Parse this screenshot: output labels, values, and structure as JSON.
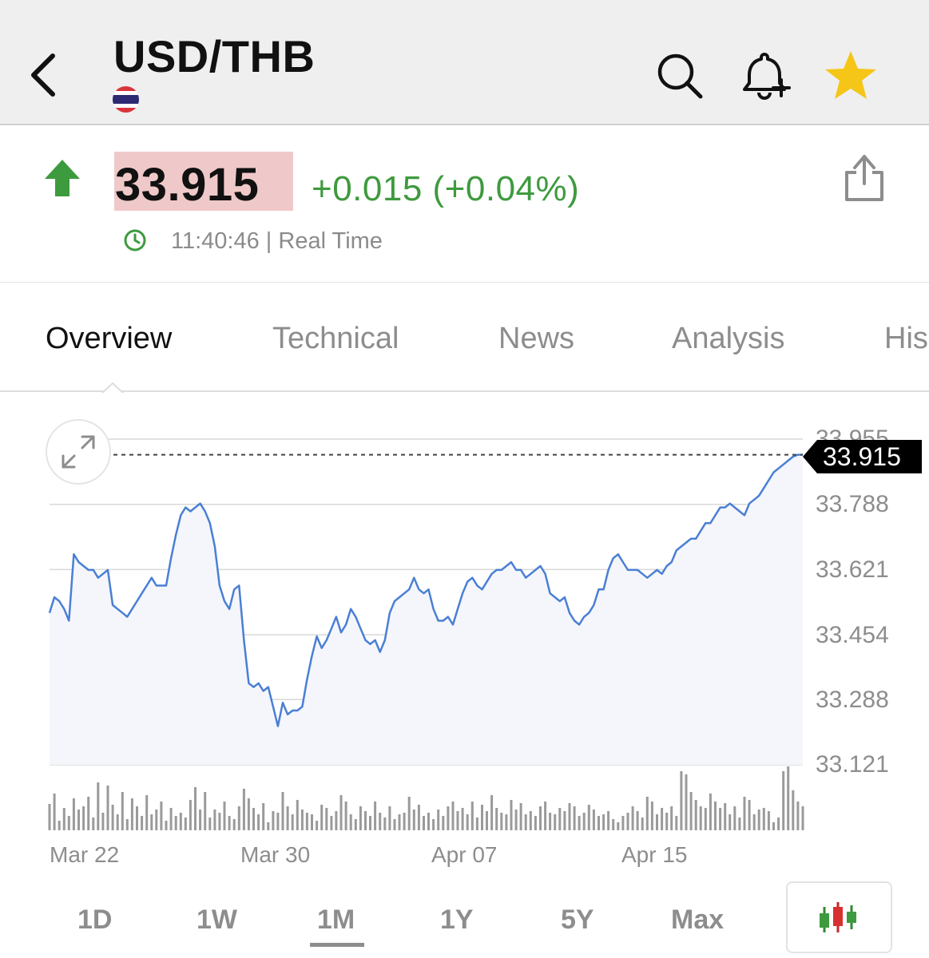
{
  "header": {
    "title": "USD/THB",
    "back_icon": "chevron-left-icon",
    "flag_icon": "thailand-flag-icon",
    "search_icon": "search-icon",
    "alert_icon": "bell-plus-icon",
    "favorite_icon": "star-icon",
    "favorite_color": "#f5c518"
  },
  "quote": {
    "direction_icon": "arrow-up-icon",
    "price": "33.915",
    "change": "+0.015 (+0.04%)",
    "change_color": "#3e9a3e",
    "price_highlight_color": "#efc9c9",
    "time_icon": "clock-icon",
    "time": "11:40:46 | Real Time",
    "share_icon": "share-icon"
  },
  "tabs": [
    {
      "label": "Overview",
      "active": true
    },
    {
      "label": "Technical",
      "active": false
    },
    {
      "label": "News",
      "active": false
    },
    {
      "label": "Analysis",
      "active": false
    },
    {
      "label": "His",
      "active": false
    }
  ],
  "chart_data": {
    "type": "area",
    "current_price_label": "33.915",
    "y_ticks": [
      "33.955",
      "33.788",
      "33.621",
      "33.454",
      "33.288",
      "33.121"
    ],
    "x_ticks": [
      "Mar 22",
      "Mar 30",
      "Apr 07",
      "Apr 15"
    ],
    "ylim": [
      33.121,
      33.955
    ],
    "line_color": "#4a7fd4",
    "fill_color": "#f4f6fb",
    "grid": true,
    "x_index_range": [
      0,
      155
    ],
    "x_tick_index": [
      0,
      40,
      80,
      120
    ],
    "series": [
      {
        "values": [
          33.51,
          33.55,
          33.54,
          33.52,
          33.49,
          33.66,
          33.64,
          33.63,
          33.62,
          33.62,
          33.6,
          33.61,
          33.62,
          33.53,
          33.52,
          33.51,
          33.5,
          33.52,
          33.54,
          33.56,
          33.58,
          33.6,
          33.58,
          33.58,
          33.58,
          33.65,
          33.71,
          33.76,
          33.78,
          33.77,
          33.78,
          33.79,
          33.77,
          33.74,
          33.68,
          33.58,
          33.54,
          33.52,
          33.57,
          33.58,
          33.44,
          33.33,
          33.32,
          33.33,
          33.31,
          33.32,
          33.27,
          33.22,
          33.28,
          33.25,
          33.26,
          33.26,
          33.27,
          33.34,
          33.4,
          33.45,
          33.42,
          33.44,
          33.47,
          33.5,
          33.46,
          33.48,
          33.52,
          33.5,
          33.47,
          33.44,
          33.43,
          33.44,
          33.41,
          33.44,
          33.51,
          33.54,
          33.55,
          33.56,
          33.57,
          33.6,
          33.57,
          33.56,
          33.57,
          33.52,
          33.49,
          33.49,
          33.5,
          33.48,
          33.52,
          33.56,
          33.59,
          33.6,
          33.58,
          33.57,
          33.59,
          33.61,
          33.62,
          33.62,
          33.63,
          33.64,
          33.62,
          33.62,
          33.6,
          33.61,
          33.62,
          33.63,
          33.61,
          33.56,
          33.55,
          33.54,
          33.55,
          33.51,
          33.49,
          33.48,
          33.5,
          33.51,
          33.53,
          33.57,
          33.57,
          33.62,
          33.65,
          33.66,
          33.64,
          33.62,
          33.62,
          33.62,
          33.61,
          33.6,
          33.61,
          33.62,
          33.61,
          33.63,
          33.64,
          33.67,
          33.68,
          33.69,
          33.7,
          33.7,
          33.72,
          33.74,
          33.74,
          33.76,
          33.78,
          33.78,
          33.79,
          33.78,
          33.77,
          33.76,
          33.79,
          33.8,
          33.81,
          33.83,
          33.85,
          33.87,
          33.88,
          33.89,
          33.9,
          33.91,
          33.915,
          33.915
        ]
      }
    ],
    "volume": [
      33,
      46,
      12,
      28,
      18,
      40,
      26,
      30,
      42,
      16,
      60,
      22,
      56,
      32,
      20,
      48,
      14,
      40,
      30,
      18,
      44,
      20,
      26,
      36,
      12,
      28,
      18,
      22,
      16,
      38,
      54,
      26,
      48,
      16,
      26,
      22,
      36,
      18,
      14,
      30,
      52,
      40,
      28,
      20,
      34,
      10,
      24,
      22,
      48,
      30,
      20,
      38,
      26,
      22,
      20,
      12,
      32,
      28,
      18,
      24,
      44,
      36,
      20,
      14,
      30,
      24,
      18,
      36,
      22,
      16,
      30,
      14,
      20,
      22,
      42,
      26,
      32,
      18,
      22,
      14,
      26,
      18,
      30,
      36,
      24,
      28,
      20,
      36,
      16,
      32,
      24,
      44,
      28,
      22,
      20,
      38,
      26,
      34,
      20,
      24,
      18,
      30,
      36,
      22,
      20,
      28,
      24,
      34,
      30,
      18,
      22,
      32,
      26,
      18,
      20,
      24,
      14,
      10,
      18,
      22,
      30,
      24,
      16,
      42,
      36,
      20,
      28,
      22,
      30,
      18,
      74,
      70,
      48,
      38,
      30,
      28,
      46,
      36,
      28,
      34,
      20,
      30,
      16,
      42,
      38,
      20,
      26,
      28,
      24,
      10,
      16,
      74,
      80,
      50,
      36,
      30
    ]
  },
  "ranges": [
    {
      "label": "1D",
      "active": false
    },
    {
      "label": "1W",
      "active": false
    },
    {
      "label": "1M",
      "active": true
    },
    {
      "label": "1Y",
      "active": false
    },
    {
      "label": "5Y",
      "active": false
    },
    {
      "label": "Max",
      "active": false
    }
  ],
  "chart_style_icon": "candlestick-icon"
}
